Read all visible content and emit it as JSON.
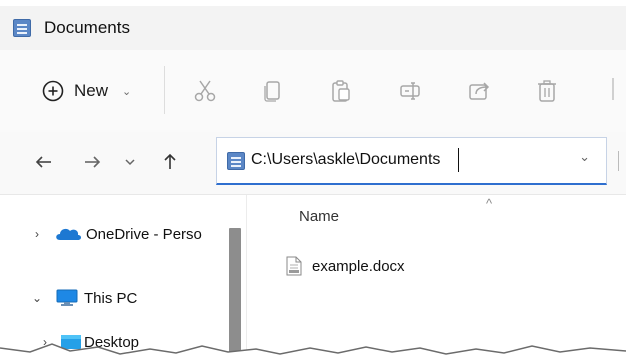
{
  "window": {
    "title": "Documents"
  },
  "toolbar": {
    "new_label": "New",
    "new_chevron": "⌄",
    "icons": [
      "cut-icon",
      "copy-icon",
      "paste-icon",
      "rename-icon",
      "share-icon",
      "delete-icon"
    ]
  },
  "address_bar": {
    "path": "C:\\Users\\askle\\Documents",
    "dropdown_chevron": "⌄"
  },
  "navigation": {
    "items": [
      {
        "label": "OneDrive - Perso",
        "expander": "›",
        "icon": "onedrive-cloud-icon"
      },
      {
        "label": "This PC",
        "expander": "⌄",
        "icon": "computer-icon"
      },
      {
        "label": "Desktop",
        "expander": "›",
        "icon": "desktop-folder-icon"
      }
    ]
  },
  "content": {
    "column_header": "Name",
    "sort_indicator": "^",
    "files": [
      {
        "name": "example.docx",
        "icon": "docx-file-icon"
      }
    ]
  },
  "colors": {
    "accent_blue": "#2f6fcf",
    "onedrive_blue": "#1d78d2",
    "pc_blue": "#1e88e5"
  }
}
